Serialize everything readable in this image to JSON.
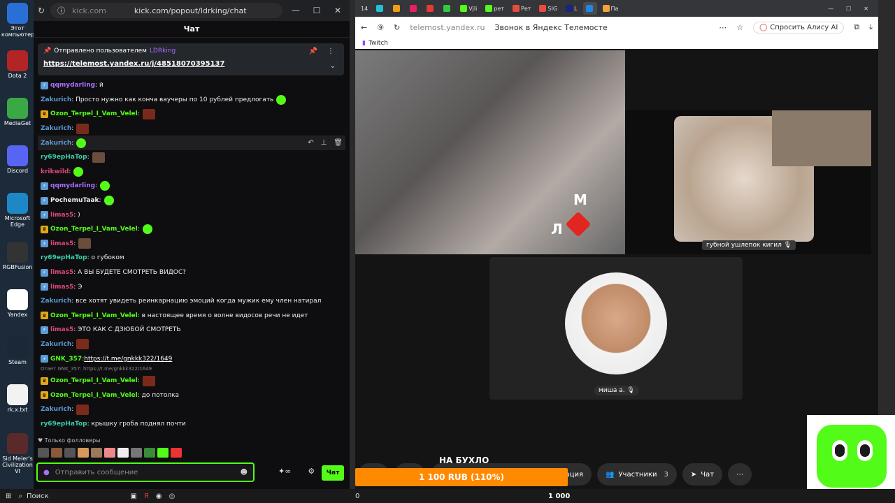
{
  "desktop": {
    "icons": [
      {
        "label": "Этот компьютер",
        "bg": "#2a6fd6"
      },
      {
        "label": "Dota 2",
        "bg": "#b32424"
      },
      {
        "label": "MediaGet",
        "bg": "#3aa845"
      },
      {
        "label": "Discord",
        "bg": "#5865f2"
      },
      {
        "label": "Microsoft Edge",
        "bg": "#1e88c6"
      },
      {
        "label": "RGBFusion",
        "bg": "#333333"
      },
      {
        "label": "Yandex",
        "bg": "#ffffff"
      },
      {
        "label": "Steam",
        "bg": "#1b2838"
      },
      {
        "label": "rk.x.txt",
        "bg": "#f2f2f2"
      },
      {
        "label": "Sid Meier's Civilization VI",
        "bg": "#5a2a2a"
      }
    ]
  },
  "kick": {
    "url_host": "kick.com",
    "url_path": "kick.com/popout/ldrking/chat",
    "chat_title": "Чат",
    "pinned": {
      "by_label": "Отправлено пользователем",
      "by_user": "LDRking",
      "link": "https://telemost.yandex.ru/j/48518070395137"
    },
    "messages": [
      {
        "user": "qqmydarling",
        "color": "#a970ff",
        "badge": "vip",
        "text": ": й",
        "emote": ""
      },
      {
        "user": "Zakurich",
        "color": "#5b9bd5",
        "badge": "",
        "text": ": Просто нужно как конча ваучеры по 10 рублей предлогать",
        "emote": "g"
      },
      {
        "user": "Ozon_Terpel_I_Vam_Velel",
        "color": "#53fc18",
        "badge": "crown",
        "text": ":",
        "emote": "r"
      },
      {
        "user": "Zakurich",
        "color": "#5b9bd5",
        "badge": "",
        "text": ":",
        "emote": "r"
      },
      {
        "user": "Zakurich",
        "color": "#5b9bd5",
        "badge": "",
        "text": ":",
        "emote": "g",
        "hl": true
      },
      {
        "user": "ry69epHaTop",
        "color": "#3ec9a7",
        "badge": "",
        "text": ":",
        "emote": "p"
      },
      {
        "user": "krikwild",
        "color": "#e0467c",
        "badge": "",
        "text": ":",
        "emote": "g"
      },
      {
        "user": "qqmydarling",
        "color": "#a970ff",
        "badge": "vip",
        "text": ":",
        "emote": "g"
      },
      {
        "user": "PochemuTaak",
        "color": "#eeeeee",
        "badge": "vip",
        "text": ":",
        "emote": "g"
      },
      {
        "user": "limas5",
        "color": "#e0467c",
        "badge": "vip",
        "text": ": )",
        "emote": ""
      },
      {
        "user": "Ozon_Terpel_I_Vam_Velel",
        "color": "#53fc18",
        "badge": "crown",
        "text": ":",
        "emote": "g"
      },
      {
        "user": "limas5",
        "color": "#e0467c",
        "badge": "vip",
        "text": ":",
        "emote": "p"
      },
      {
        "user": "ry69epHaTop",
        "color": "#3ec9a7",
        "badge": "",
        "text": ": о губоком",
        "emote": ""
      },
      {
        "user": "limas5",
        "color": "#e0467c",
        "badge": "vip",
        "text": ": А ВЫ БУДЕТЕ СМОТРЕТЬ ВИДОС?",
        "emote": ""
      },
      {
        "user": "limas5",
        "color": "#e0467c",
        "badge": "vip",
        "text": ": Э",
        "emote": ""
      },
      {
        "user": "Zakurich",
        "color": "#5b9bd5",
        "badge": "",
        "text": ": все хотят увидеть реинкарнацию эмоций когда мужик ему член натирал",
        "emote": ""
      },
      {
        "user": "Ozon_Terpel_I_Vam_Velel",
        "color": "#53fc18",
        "badge": "crown",
        "text": ": в настоящее время о волне видосов речи не идет",
        "emote": ""
      },
      {
        "user": "limas5",
        "color": "#e0467c",
        "badge": "vip",
        "text": ": ЭТО КАК С ДЗЮБОЙ СМОТРЕТЬ",
        "emote": ""
      },
      {
        "user": "Zakurich",
        "color": "#5b9bd5",
        "badge": "",
        "text": ":",
        "emote": "r"
      },
      {
        "user": "GNK_357",
        "color": "#53fc18",
        "badge": "vip",
        "text": ": ",
        "link": "https://t.me/gnkkk322/1649",
        "emote": ""
      }
    ],
    "reply_line": "Ответ GNK_357: https://t.me/gnkkk322/1649",
    "messages2": [
      {
        "user": "Ozon_Terpel_I_Vam_Velel",
        "color": "#53fc18",
        "badge": "crown",
        "text": ":",
        "emote": "r"
      },
      {
        "user": "Ozon_Terpel_I_Vam_Velel",
        "color": "#53fc18",
        "badge": "crown",
        "text": ": до потолка",
        "emote": ""
      },
      {
        "user": "Zakurich",
        "color": "#5b9bd5",
        "badge": "",
        "text": ":",
        "emote": "r"
      },
      {
        "user": "ry69epHaTop",
        "color": "#3ec9a7",
        "badge": "",
        "text": ": крышку гроба поднял почти",
        "emote": ""
      }
    ],
    "followers_only": "Только фолловеры",
    "input_placeholder": "Отправить сообщение",
    "send_label": "Чат"
  },
  "telemost": {
    "tab_count": "14",
    "tabs": [
      "",
      "",
      "",
      "",
      "",
      "Vjli",
      "рет",
      "Рет",
      "SIG",
      "L",
      "",
      "Па"
    ],
    "url_host": "telemost.yandex.ru",
    "page_title": "Звонок в Яндекс Телемосте",
    "alice_label": "Спросить Алису AI",
    "bookmark": "Twitch",
    "share_label": "губной ушлепок кигил",
    "person_name": "миша а.",
    "controls": {
      "demo_label": "ация",
      "participants_label": "Участники",
      "participants_count": "3",
      "chat_label": "Чат",
      "more_label": "⋯"
    }
  },
  "donation": {
    "title": "НА БУХЛО",
    "amount": "1 100 RUB (110%)",
    "min": "0",
    "max": "1 000"
  },
  "taskbar": {
    "search_label": "Поиск"
  }
}
